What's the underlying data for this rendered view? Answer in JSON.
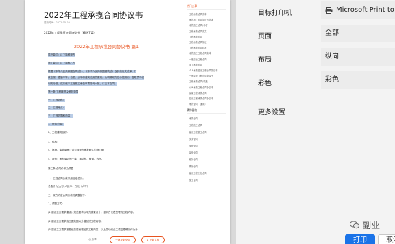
{
  "doc": {
    "title": "2022年工程承揽合同协议书",
    "meta": "更新时间：2022-05-20",
    "subtitle": "2022年工程承揽合同协议书（精选7篇）",
    "red_title": "2022年工程承揽合同协议书 篇1",
    "lines": [
      {
        "text": "委托单位：以下简称甲方",
        "hl": true
      },
      {
        "text": "施工单位：以下简称乙方",
        "hl": true
      },
      {
        "text": "根据《中华人民共和国合同法》、《中华人民共和国建筑法》及其他有关法律、行",
        "hl": true
      },
      {
        "text": "政法规，遵循平等、自愿、公平和诚实信用的原则，为明确双方在承揽期内，各职责与权",
        "hl": true
      },
      {
        "text": "利的分担，双方就本工程施工承包事项协商一致，订立本合同。",
        "hl": true
      },
      {
        "text": "第一条 工程概况及承包范围",
        "hl": true
      },
      {
        "text": "一、工程名称：",
        "hl": true
      },
      {
        "text": "二、工程地点：",
        "hl": true
      },
      {
        "text": "三、工程范围和内容：",
        "hl": true
      },
      {
        "text": "1、承包范围：",
        "hl": true
      },
      {
        "text": "2、工程建筑面积：",
        "hl": false
      },
      {
        "text": "3、结构：",
        "hl": false
      },
      {
        "text": "4、措施、建筑屋面：详见双甲方审批确认的施工图",
        "hl": false
      },
      {
        "text": "5、其他：承担周边的土建、钢结构、管道、线杆。",
        "hl": false
      },
      {
        "text": "第二条 合同价款及调整",
        "hl": false
      },
      {
        "text": "一、工程合同价款采用固定总价。",
        "hl": false
      },
      {
        "text": "总造价为(大写)人民币：万元（大写）",
        "hl": false
      },
      {
        "text": "二、双方约定合同价款的调整如下：",
        "hl": false
      },
      {
        "text": "1、调整方式：",
        "hl": false
      },
      {
        "text": "(1)建设主方要求建设计规范要求以甲方变更设计，报甲方代表签署的工程内容。",
        "hl": false
      },
      {
        "text": "(2)建设主方要求施工图范围以外增加的工程内容。",
        "hl": false
      },
      {
        "text": "(3)建设主方要求按图纸变更而增加的工程内容，以上变动经业主或监理确认作为计",
        "hl": false
      }
    ]
  },
  "sidebar": {
    "head": "热门文章",
    "items": [
      "工程承揽合同范本",
      "承揽加工合同协议书范本",
      "承揽加工合同(参考)",
      "工程承揽合同范文",
      "工程承揽合同",
      "工程承揽合同协议",
      "工程承揽合同标准",
      "承揽加工工程合同范本",
      "一般建设工程合同",
      "加工承揽合同",
      "个人承揽建设工程合同协议书",
      "一般建设工程合同协议书",
      "工程承揽合同(精选)",
      "公司承揽工程合同协议书",
      "最新工程承揽合同",
      "建设工程承揽合同协议书",
      "承揽合同（通用）"
    ],
    "head2": "猜你喜欢",
    "items2": [
      "承揽合同",
      "工程施工合同",
      "建设工程施工合同",
      "劳务合同",
      "采购合同",
      "装修合同",
      "租赁合同",
      "购销合同",
      "建设工程分包合同",
      "施工合同"
    ]
  },
  "bottom": {
    "share": "◎ 分享",
    "download": "一键复制全文",
    "buy": "↓ 下载文档"
  },
  "settings": {
    "printer_label": "目标打印机",
    "printer_value": "Microsoft Print to PDF",
    "pages_label": "页面",
    "pages_value": "全部",
    "layout_label": "布局",
    "layout_value": "纵向",
    "color_label": "彩色",
    "color_value": "彩色",
    "more_label": "更多设置",
    "watermark": "副业",
    "print_label": "打印",
    "cancel_label": "取消"
  },
  "colors": {
    "accent": "#e8531f",
    "highlight": "#b9cce6",
    "primary": "#1a73e8"
  }
}
